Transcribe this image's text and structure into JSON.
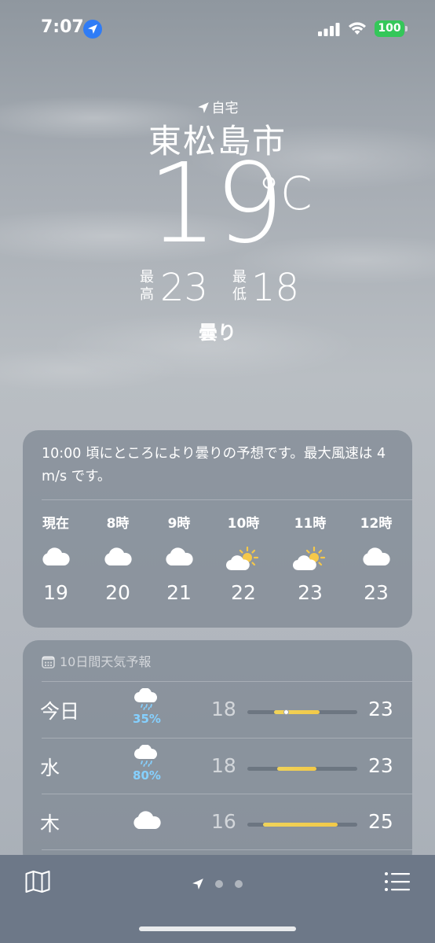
{
  "status_bar": {
    "time": "7:07",
    "battery": "100"
  },
  "location": {
    "label": "自宅",
    "city": "東松島市",
    "temperature": "19",
    "unit": "°C",
    "high_label": "最高",
    "high": "23",
    "low_label": "最低",
    "low": "18",
    "condition": "曇り"
  },
  "hourly": {
    "summary": "10:00 頃にところにより曇りの予想です。最大風速は 4 m/s です。",
    "items": [
      {
        "label": "現在",
        "icon": "cloud-icon",
        "temp": "19"
      },
      {
        "label": "8時",
        "icon": "cloud-icon",
        "temp": "20"
      },
      {
        "label": "9時",
        "icon": "cloud-icon",
        "temp": "21"
      },
      {
        "label": "10時",
        "icon": "partly-sunny-icon",
        "temp": "22"
      },
      {
        "label": "11時",
        "icon": "partly-sunny-icon",
        "temp": "23"
      },
      {
        "label": "12時",
        "icon": "cloud-icon",
        "temp": "23"
      }
    ]
  },
  "daily": {
    "title": "10日間天気予報",
    "rows": [
      {
        "day": "今日",
        "icon": "rain-icon",
        "precip": "35%",
        "low": "18",
        "high": "23",
        "range_start": 0.24,
        "range_end": 0.66,
        "current": 0.35
      },
      {
        "day": "水",
        "icon": "rain-icon",
        "precip": "80%",
        "low": "18",
        "high": "23",
        "range_start": 0.27,
        "range_end": 0.63,
        "current": null
      },
      {
        "day": "木",
        "icon": "cloud-icon",
        "precip": "",
        "low": "16",
        "high": "25",
        "range_start": 0.14,
        "range_end": 0.82,
        "current": null
      }
    ]
  },
  "colors": {
    "battery": "#34c759",
    "location_badge": "#2f7cf6",
    "range_bar": "#f0d35a",
    "precip": "#85d0ff"
  }
}
